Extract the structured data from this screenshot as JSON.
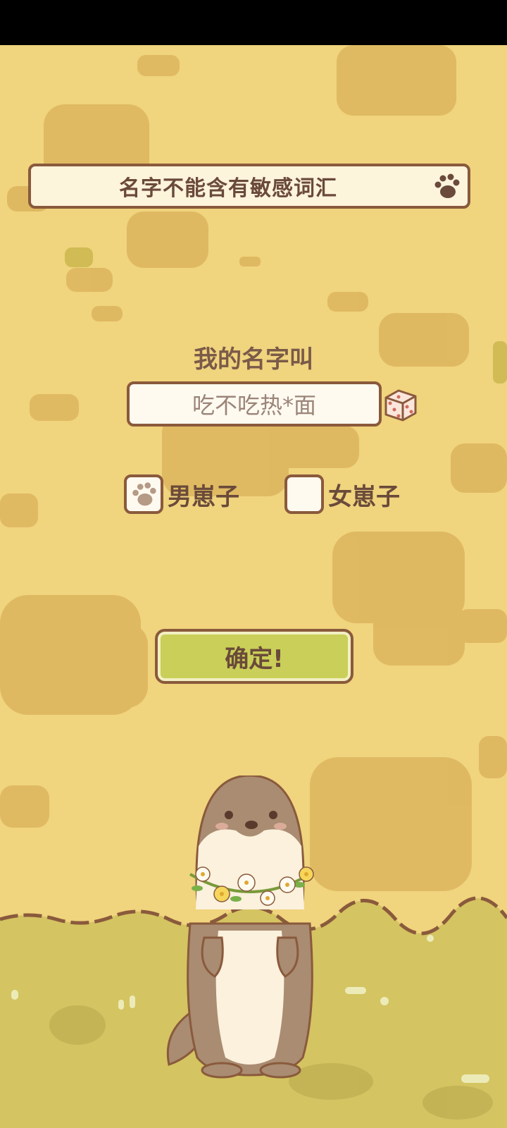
{
  "notice": {
    "text": "名字不能含有敏感词汇",
    "icon": "paw-icon"
  },
  "form": {
    "prompt": "我的名字叫",
    "name_value": "吃不吃热*面",
    "random_icon": "dice-icon",
    "genders": [
      {
        "label": "男崽子",
        "selected": true
      },
      {
        "label": "女崽子",
        "selected": false
      }
    ],
    "confirm_label": "确定!"
  },
  "colors": {
    "background": "#f0d47e",
    "border": "#8a5a3c",
    "confirm": "#c9cf58",
    "text": "#6a4a3a"
  }
}
